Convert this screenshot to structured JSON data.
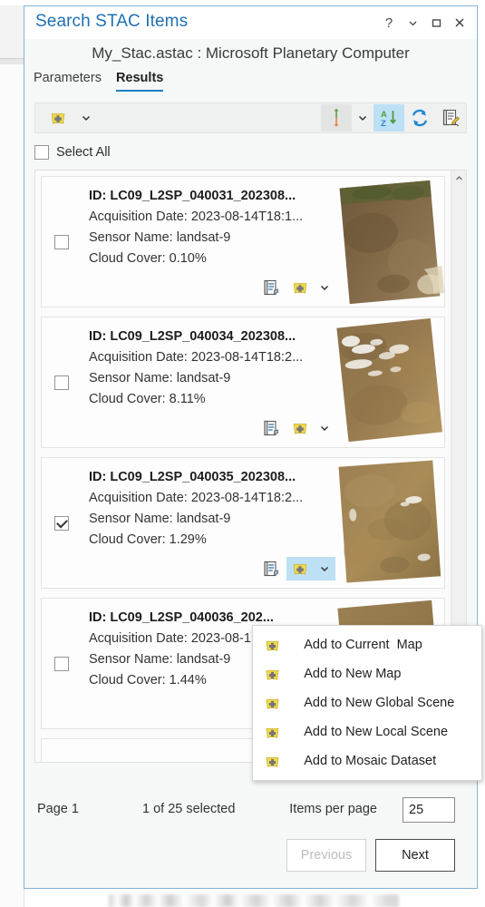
{
  "window": {
    "title": "Search STAC Items",
    "controls": [
      {
        "name": "help-button",
        "glyph": "?"
      },
      {
        "name": "dropdown-button",
        "glyph": "chevron-down"
      },
      {
        "name": "maximize-button",
        "glyph": "square"
      },
      {
        "name": "close-button",
        "glyph": "times"
      }
    ],
    "subtitle": "My_Stac.astac : Microsoft Planetary Computer"
  },
  "tabs": [
    {
      "label": "Parameters",
      "active": false
    },
    {
      "label": "Results",
      "active": true
    }
  ],
  "toolbar": {
    "add_data_icon": "add-data-icon",
    "add_data_chevron": "chevron-down-icon",
    "sort_direction_icon": "sort-updown-icon",
    "sort_direction_chevron": "chevron-down-icon",
    "sort_az_icon": "sort-az-icon",
    "refresh_icon": "refresh-icon",
    "edit_report_icon": "edit-report-icon"
  },
  "select_all": {
    "label": "Select All",
    "checked": false
  },
  "results": [
    {
      "id_label": "ID: LC09_L2SP_040031_202308...",
      "acquisition": "Acquisition Date: 2023-08-14T18:1...",
      "sensor": "Sensor Name: landsat-9",
      "cloud": "Cloud Cover: 0.10%",
      "checked": false,
      "add_active": false,
      "show_add": true,
      "thumb": "scene-thumbnail-1"
    },
    {
      "id_label": "ID: LC09_L2SP_040034_202308...",
      "acquisition": "Acquisition Date: 2023-08-14T18:2...",
      "sensor": "Sensor Name: landsat-9",
      "cloud": "Cloud Cover: 8.11%",
      "checked": false,
      "add_active": false,
      "show_add": true,
      "thumb": "scene-thumbnail-2"
    },
    {
      "id_label": "ID: LC09_L2SP_040035_202308...",
      "acquisition": "Acquisition Date: 2023-08-14T18:2...",
      "sensor": "Sensor Name: landsat-9",
      "cloud": "Cloud Cover: 1.29%",
      "checked": true,
      "add_active": true,
      "show_add": true,
      "thumb": "scene-thumbnail-3"
    },
    {
      "id_label": "ID: LC09_L2SP_040036_202...",
      "acquisition": "Acquisition Date: 2023-08-1...",
      "sensor": "Sensor Name: landsat-9",
      "cloud": "Cloud Cover: 1.44%",
      "checked": false,
      "add_active": false,
      "show_add": false,
      "thumb": "scene-thumbnail-4"
    },
    {
      "id_label": "",
      "acquisition": "",
      "sensor": "",
      "cloud": "",
      "checked": false,
      "add_active": false,
      "show_add": false,
      "thumb": "scene-thumbnail-5"
    }
  ],
  "menu": {
    "open": true,
    "items": [
      {
        "label": "Add to Current  Map",
        "icon": "add-data-icon"
      },
      {
        "label": "Add to New Map",
        "icon": "add-data-icon"
      },
      {
        "label": "Add to New Global Scene",
        "icon": "add-data-icon"
      },
      {
        "label": "Add to New Local Scene",
        "icon": "add-data-icon"
      },
      {
        "label": "Add to Mosaic Dataset",
        "icon": "add-data-icon"
      }
    ]
  },
  "footer": {
    "page_label": "Page 1",
    "selection_label": "1 of 25 selected",
    "items_per_page_label": "Items per page",
    "items_per_page_value": "25",
    "previous_label": "Previous",
    "previous_disabled": true,
    "next_label": "Next"
  },
  "colors": {
    "title_blue": "#1f6fb2",
    "accent_blue": "#1f7fc4",
    "highlight_blue": "#bde0f5",
    "dialog_border": "#84b4d6",
    "icon_yellow": "#ebd44a"
  }
}
